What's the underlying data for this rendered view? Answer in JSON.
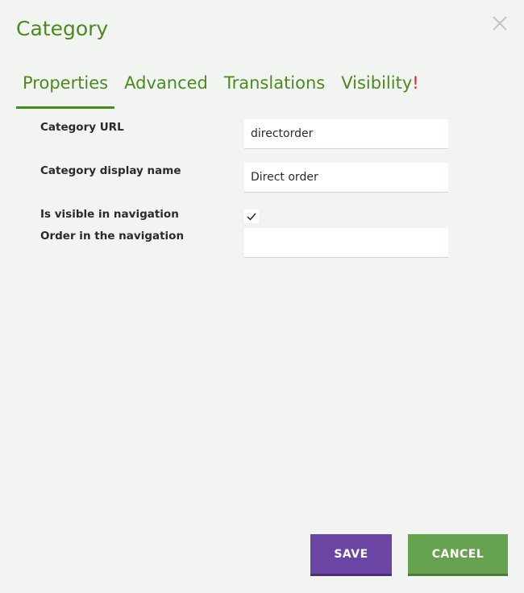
{
  "dialog": {
    "title": "Category"
  },
  "tabs": [
    {
      "label": "Properties",
      "active": true
    },
    {
      "label": "Advanced",
      "active": false
    },
    {
      "label": "Translations",
      "active": false
    },
    {
      "label": "Visibility",
      "warning": "!",
      "active": false
    }
  ],
  "form": {
    "category_url": {
      "label": "Category URL",
      "value": "directorder"
    },
    "display_name": {
      "label": "Category display name",
      "value": "Direct order"
    },
    "visible_in_navigation": {
      "label": "Is visible in navigation",
      "checked": true
    },
    "navigation_order": {
      "label": "Order in the navigation",
      "value": ""
    }
  },
  "actions": {
    "save_label": "SAVE",
    "cancel_label": "CANCEL"
  },
  "colors": {
    "accent": "#4a8a1e",
    "save": "#6a45a3",
    "cancel": "#66a250",
    "warning": "#e0201a"
  },
  "icons": {
    "close": "close-icon",
    "checkbox_check": "check-icon"
  }
}
